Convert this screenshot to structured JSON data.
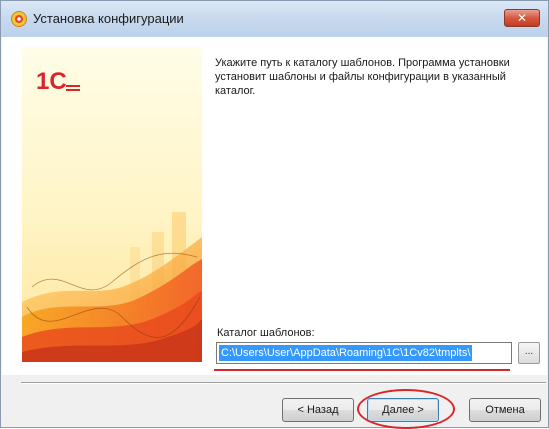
{
  "window": {
    "title": "Установка конфигурации",
    "close_label": "✕"
  },
  "banner": {
    "logo_text": "1С"
  },
  "main": {
    "instruction": "Укажите путь к каталогу шаблонов. Программа установки установит шаблоны и файлы конфигурации в указанный каталог.",
    "path_label": "Каталог шаблонов:",
    "path_value": "C:\\Users\\User\\AppData\\Roaming\\1C\\1Cv82\\tmplts\\",
    "browse_label": "..."
  },
  "buttons": {
    "back_label": "< Назад",
    "next_label": "Далее >",
    "cancel_label": "Отмена"
  },
  "colors": {
    "accent_selection": "#3399ff",
    "annotation_red": "#d8262a",
    "banner_orange": "#f08a1c"
  }
}
